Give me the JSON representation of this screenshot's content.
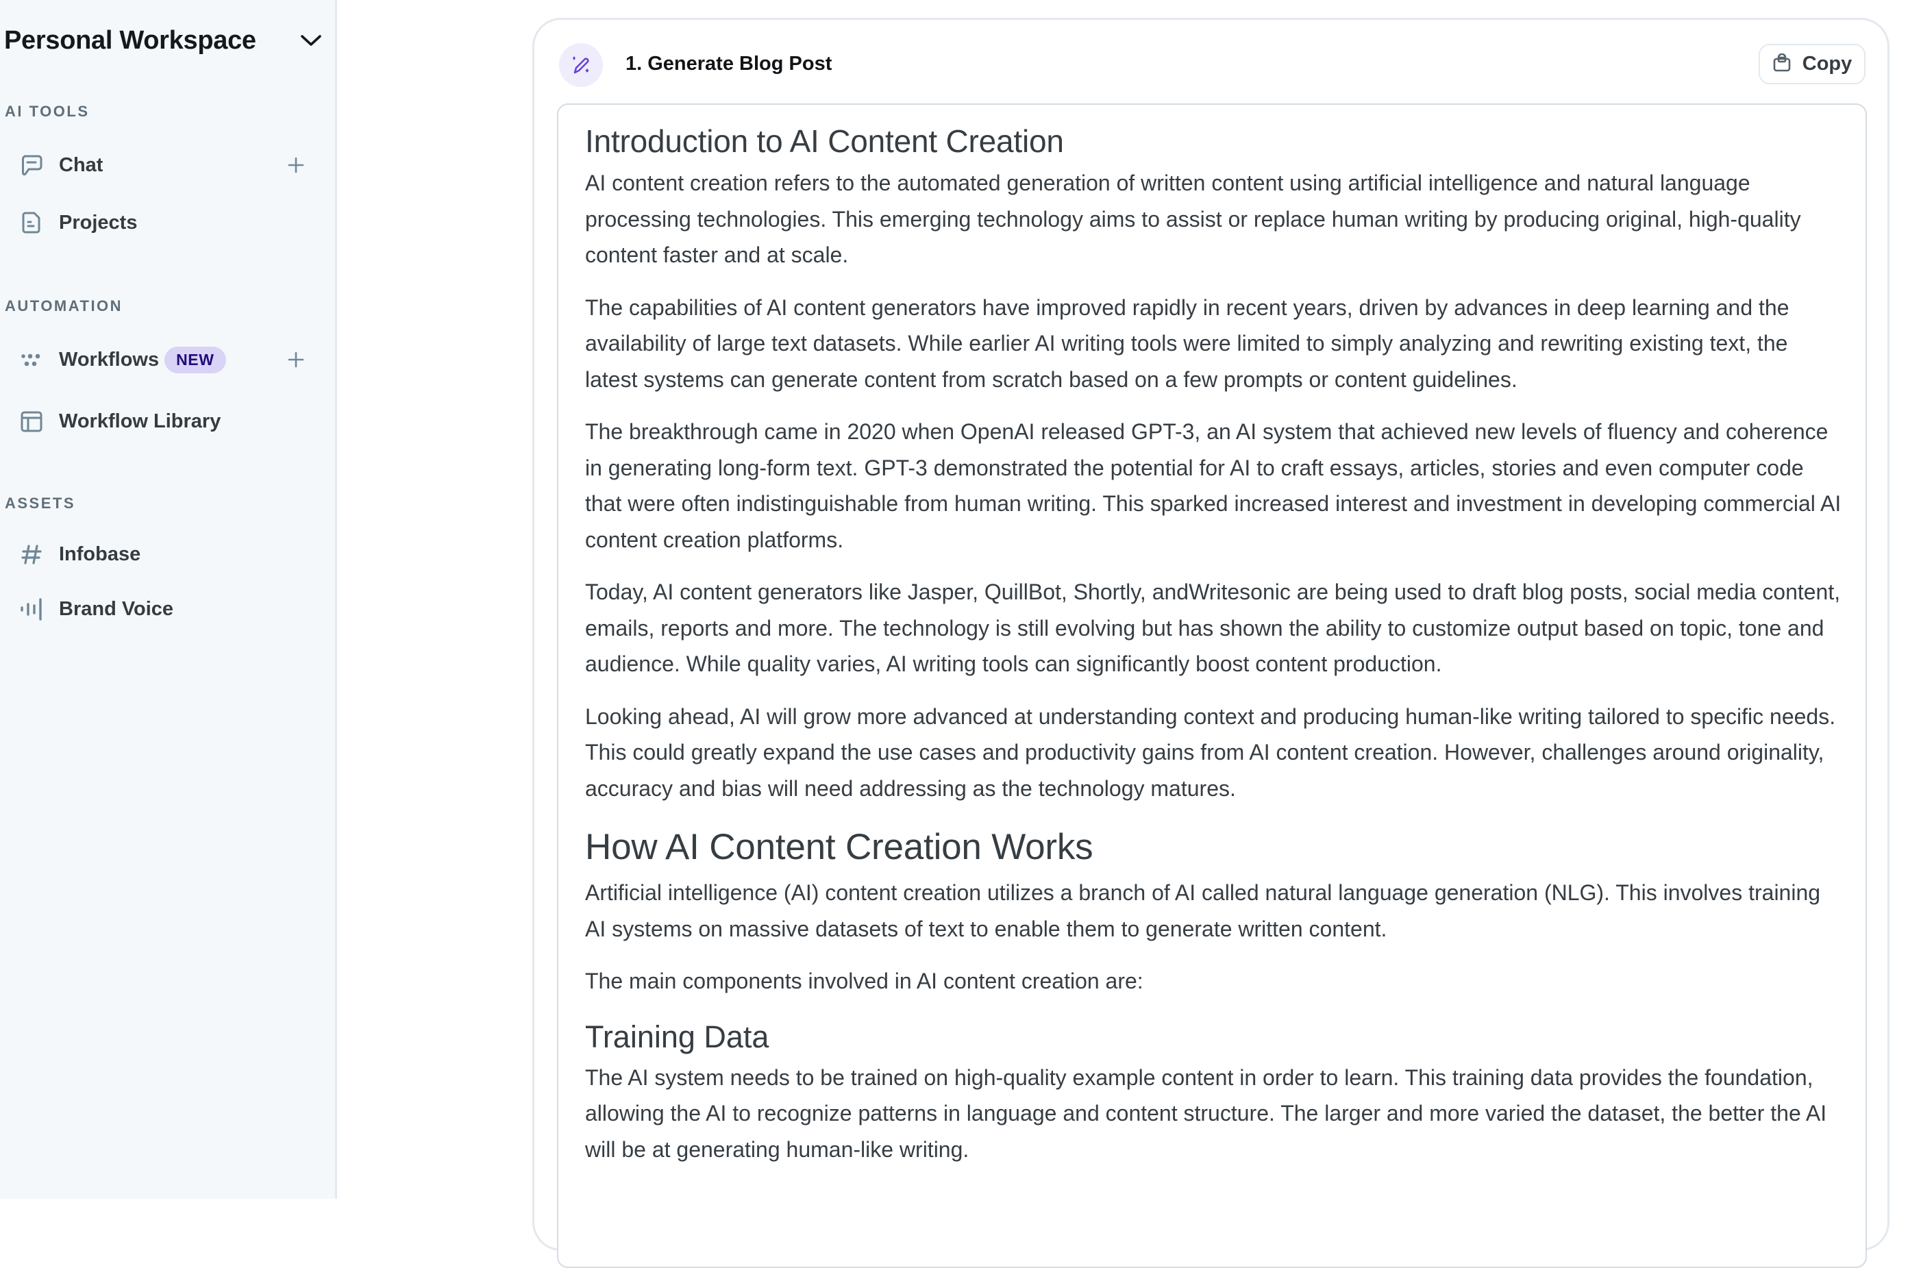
{
  "sidebar": {
    "workspace_title": "Personal Workspace",
    "sections": [
      {
        "label": "AI TOOLS",
        "items": [
          {
            "label": "Chat",
            "icon": "chat-icon",
            "has_add": true
          },
          {
            "label": "Projects",
            "icon": "document-icon",
            "has_add": false
          }
        ]
      },
      {
        "label": "AUTOMATION",
        "items": [
          {
            "label": "Workflows",
            "icon": "workflow-dots-icon",
            "badge": "NEW",
            "has_add": true
          },
          {
            "label": "Workflow Library",
            "icon": "layout-icon",
            "has_add": false
          }
        ]
      },
      {
        "label": "ASSETS",
        "items": [
          {
            "label": "Infobase",
            "icon": "hash-icon",
            "has_add": false
          },
          {
            "label": "Brand Voice",
            "icon": "audio-bars-icon",
            "has_add": false
          }
        ]
      }
    ]
  },
  "card": {
    "step_title": "1. Generate Blog Post",
    "step_icon": "magic-pen-icon",
    "copy_label": "Copy",
    "accent_color": "#6a42d6"
  },
  "article": {
    "h1": "Introduction to AI Content Creation",
    "intro_paragraphs": [
      "AI content creation refers to the automated generation of written content using artificial intelligence and natural language processing technologies. This emerging technology aims to assist or replace human writing by producing original, high-quality content faster and at scale.",
      "The capabilities of AI content generators have improved rapidly in recent years, driven by advances in deep learning and the availability of large text datasets. While earlier AI writing tools were limited to simply analyzing and rewriting existing text, the latest systems can generate content from scratch based on a few prompts or content guidelines.",
      "The breakthrough came in 2020 when OpenAI released GPT-3, an AI system that achieved new levels of fluency and coherence in generating long-form text. GPT-3 demonstrated the potential for AI to craft essays, articles, stories and even computer code that were often indistinguishable from human writing. This sparked increased interest and investment in developing commercial AI content creation platforms.",
      "Today, AI content generators like Jasper, QuillBot, Shortly, andWritesonic are being used to draft blog posts, social media content, emails, reports and more. The technology is still evolving but has shown the ability to customize output based on topic, tone and audience. While quality varies, AI writing tools can significantly boost content production.",
      "Looking ahead, AI will grow more advanced at understanding context and producing human-like writing tailored to specific needs. This could greatly expand the use cases and productivity gains from AI content creation. However, challenges around originality, accuracy and bias will need addressing as the technology matures."
    ],
    "h2": "How AI Content Creation Works",
    "how_paragraphs": [
      "Artificial intelligence (AI) content creation utilizes a branch of AI called natural language generation (NLG). This involves training AI systems on massive datasets of text to enable them to generate written content.",
      "The main components involved in AI content creation are:"
    ],
    "h3": "Training Data",
    "training_paragraphs": [
      "The AI system needs to be trained on high-quality example content in order to learn. This training data provides the foundation, allowing the AI to recognize patterns in language and content structure. The larger and more varied the dataset, the better the AI will be at generating human-like writing."
    ]
  }
}
